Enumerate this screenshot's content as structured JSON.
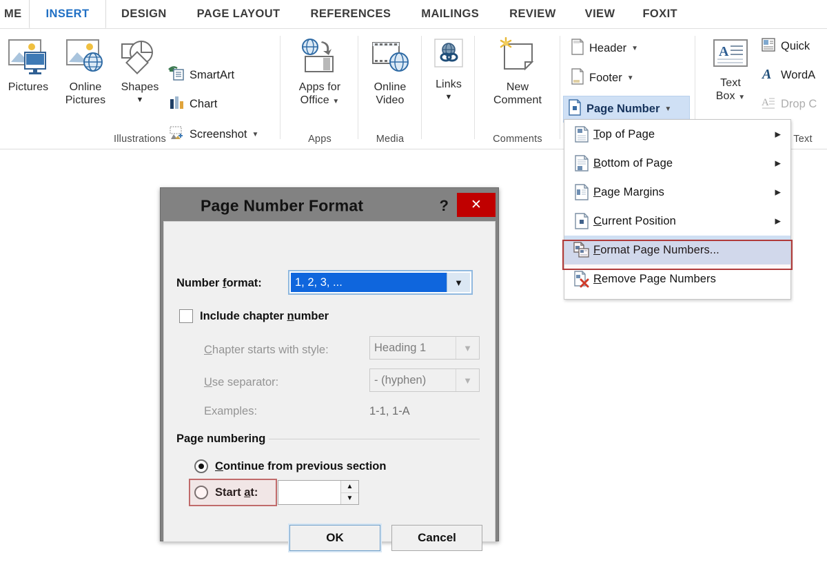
{
  "ribbon": {
    "tabs": [
      {
        "label": "ME",
        "active": false,
        "clipped": true
      },
      {
        "label": "INSERT",
        "active": true
      },
      {
        "label": "DESIGN",
        "active": false
      },
      {
        "label": "PAGE LAYOUT",
        "active": false
      },
      {
        "label": "REFERENCES",
        "active": false
      },
      {
        "label": "MAILINGS",
        "active": false
      },
      {
        "label": "REVIEW",
        "active": false
      },
      {
        "label": "VIEW",
        "active": false
      },
      {
        "label": "FOXIT",
        "active": false
      }
    ],
    "groups": {
      "illustrations": {
        "label": "Illustrations",
        "pictures": "Pictures",
        "online_pictures_1": "Online",
        "online_pictures_2": "Pictures",
        "shapes": "Shapes",
        "smartart": "SmartArt",
        "chart": "Chart",
        "screenshot": "Screenshot"
      },
      "apps": {
        "label": "Apps",
        "apps_for_office_1": "Apps for",
        "apps_for_office_2": "Office"
      },
      "media": {
        "label": "Media",
        "online_video_1": "Online",
        "online_video_2": "Video"
      },
      "links": {
        "label": "",
        "links": "Links"
      },
      "comments": {
        "label": "Comments",
        "new_comment_1": "New",
        "new_comment_2": "Comment"
      },
      "header_footer": {
        "label": "",
        "header": "Header",
        "footer": "Footer",
        "page_number": "Page Number"
      },
      "text": {
        "label": "Text",
        "text_box_1": "Text",
        "text_box_2": "Box",
        "quick_parts": "Quick",
        "wordart": "WordA",
        "drop_cap": "Drop C"
      }
    }
  },
  "page_number_menu": {
    "items": [
      {
        "label_pre": "",
        "label_u": "T",
        "label_post": "op of Page",
        "icon": "page-top-icon",
        "submenu": true,
        "highlight": false
      },
      {
        "label_pre": "",
        "label_u": "B",
        "label_post": "ottom of Page",
        "icon": "page-bottom-icon",
        "submenu": true,
        "highlight": false
      },
      {
        "label_pre": "",
        "label_u": "P",
        "label_post": "age Margins",
        "icon": "page-margins-icon",
        "submenu": true,
        "highlight": false
      },
      {
        "label_pre": "",
        "label_u": "C",
        "label_post": "urrent Position",
        "icon": "current-position-icon",
        "submenu": true,
        "highlight": false
      },
      {
        "label_pre": "",
        "label_u": "F",
        "label_post": "ormat Page Numbers...",
        "icon": "format-page-numbers-icon",
        "submenu": false,
        "highlight": true
      },
      {
        "label_pre": "",
        "label_u": "R",
        "label_post": "emove Page Numbers",
        "icon": "remove-page-numbers-icon",
        "submenu": false,
        "highlight": false
      }
    ]
  },
  "dialog": {
    "title": "Page Number Format",
    "help_label": "?",
    "close_label": "✕",
    "number_format": {
      "label_pre": "Number ",
      "label_u": "f",
      "label_post": "ormat:",
      "value": "1, 2, 3, ..."
    },
    "include_chapter": {
      "label_pre": "Include chapter ",
      "label_u": "n",
      "label_post": "umber",
      "checked": false
    },
    "chapter_style": {
      "label_pre": "",
      "label_u": "C",
      "label_post": "hapter starts with style:",
      "value": "Heading 1",
      "disabled": true
    },
    "separator": {
      "label_pre": "",
      "label_u": "U",
      "label_post": "se separator:",
      "value": "-   (hyphen)",
      "disabled": true
    },
    "examples": {
      "label": "Examples:",
      "value": "1-1, 1-A"
    },
    "page_numbering": {
      "group_label": "Page numbering",
      "continue": {
        "label_pre": "",
        "label_u": "C",
        "label_post": "ontinue from previous section",
        "selected": true
      },
      "start_at": {
        "label_pre": "Start ",
        "label_u": "a",
        "label_post": "t:",
        "selected": false,
        "value": ""
      }
    },
    "buttons": {
      "ok": "OK",
      "cancel": "Cancel"
    }
  },
  "colors": {
    "accent_tab": "#1f6fc4",
    "close_button": "#c00000",
    "selection_blue": "#0f66dd",
    "menu_highlight": "#cfdff3",
    "annotation_red": "#b03a3a",
    "annotation_pink": "#c06a6a"
  }
}
